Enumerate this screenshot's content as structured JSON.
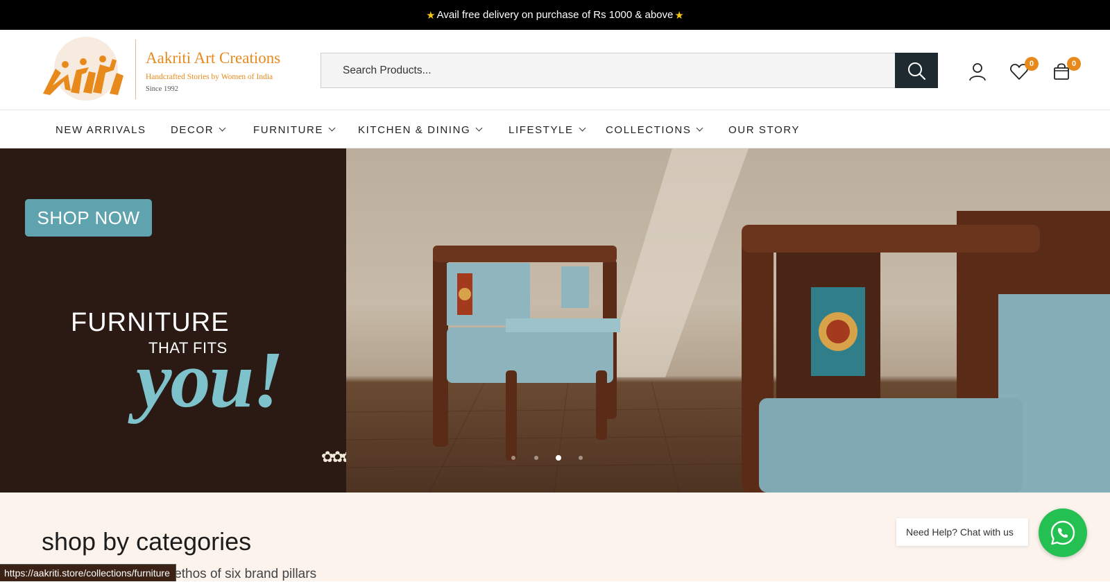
{
  "announcement": {
    "text": "Avail free delivery on purchase of Rs 1000 & above",
    "icon": "star-icon"
  },
  "brand": {
    "name": "Aakriti Art Creations",
    "tagline": "Handcrafted Stories by Women of India",
    "since": "Since 1992",
    "mark_text": "Aakriti",
    "accent_color": "#e8891c"
  },
  "search": {
    "placeholder": "Search Products..."
  },
  "header_icons": {
    "wishlist_count": "0",
    "cart_count": "0"
  },
  "nav": {
    "items": [
      {
        "label": "NEW ARRIVALS",
        "has_dropdown": false
      },
      {
        "label": "DECOR",
        "has_dropdown": true
      },
      {
        "label": "FURNITURE",
        "has_dropdown": true
      },
      {
        "label": "KITCHEN & DINING",
        "has_dropdown": true
      },
      {
        "label": "LIFESTYLE",
        "has_dropdown": true
      },
      {
        "label": "COLLECTIONS",
        "has_dropdown": true
      },
      {
        "label": "OUR STORY",
        "has_dropdown": false
      }
    ]
  },
  "hero": {
    "cta": "SHOP NOW",
    "line1": "FURNITURE",
    "line2": "THAT FITS",
    "line3": "you!",
    "slides": 4,
    "active_slide": 3
  },
  "categories": {
    "title": "shop by categories",
    "subtitle": "ollection based on our ethos of six brand pillars"
  },
  "chat": {
    "label": "Need Help? Chat with us"
  },
  "status_bar": {
    "url": "https://aakriti.store/collections/furniture"
  }
}
